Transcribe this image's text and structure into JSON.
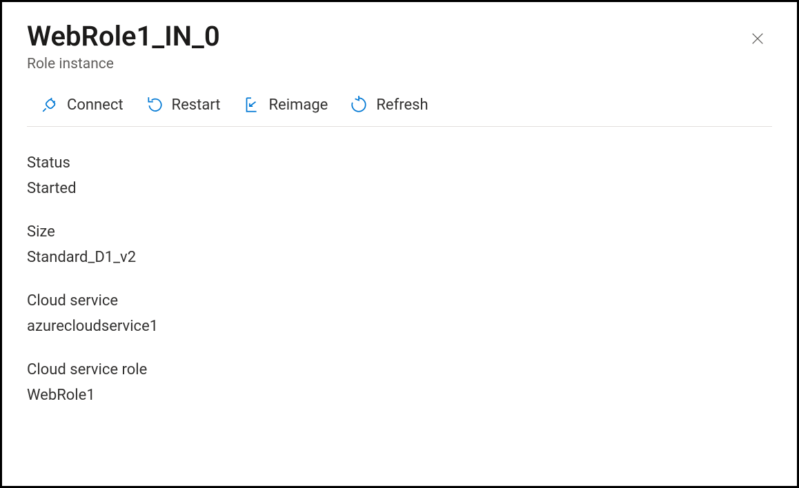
{
  "header": {
    "title": "WebRole1_IN_0",
    "subtitle": "Role instance"
  },
  "toolbar": {
    "connect_label": "Connect",
    "restart_label": "Restart",
    "reimage_label": "Reimage",
    "refresh_label": "Refresh"
  },
  "properties": {
    "status_label": "Status",
    "status_value": "Started",
    "size_label": "Size",
    "size_value": "Standard_D1_v2",
    "cloud_service_label": "Cloud service",
    "cloud_service_value": "azurecloudservice1",
    "cloud_service_role_label": "Cloud service role",
    "cloud_service_role_value": "WebRole1"
  }
}
